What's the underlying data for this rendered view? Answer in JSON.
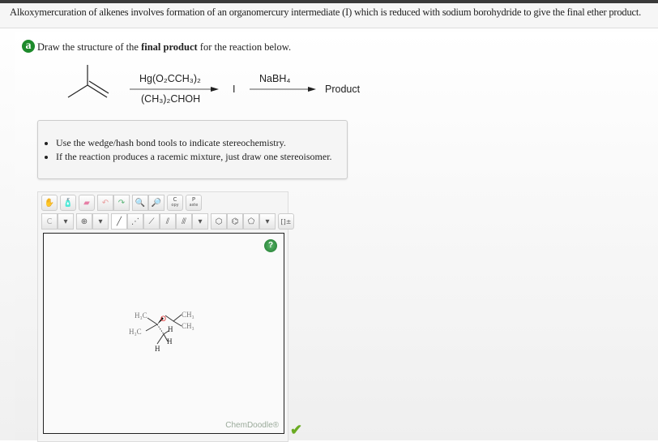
{
  "header": {
    "text": "Alkoxymercuration of alkenes involves formation of an organomercury intermediate (I) which is reduced with sodium borohydride to give the final ether product."
  },
  "question": {
    "badge": "a",
    "prompt_pre": "Draw the structure of the ",
    "prompt_bold": "final product",
    "prompt_post": " for the reaction below."
  },
  "reaction": {
    "reagent1_top": "Hg(O₂CCH₃)₂",
    "reagent1_bottom": "(CH₃)₂CHOH",
    "intermediate": "I",
    "reagent2": "NaBH₄",
    "product": "Product"
  },
  "instructions": [
    "Use the wedge/hash bond tools to indicate stereochemistry.",
    "If the reaction produces a racemic mixture, just draw one stereoisomer."
  ],
  "toolbar": {
    "c_label": "C",
    "c_sub": "opy",
    "p_label": "P",
    "p_sub": "aste",
    "atom": "C",
    "charge": "⊕",
    "bracket": "[]±"
  },
  "molecule": {
    "h3c1": "H₃C",
    "h3c2": "H₃C",
    "o": "O",
    "ch3a": "CH₃",
    "ch3b": "CH₃",
    "h1": "H",
    "h2": "H",
    "h3": "H"
  },
  "editor": {
    "help": "?",
    "brand": "ChemDoodle®"
  },
  "status": {
    "check": "✔"
  }
}
